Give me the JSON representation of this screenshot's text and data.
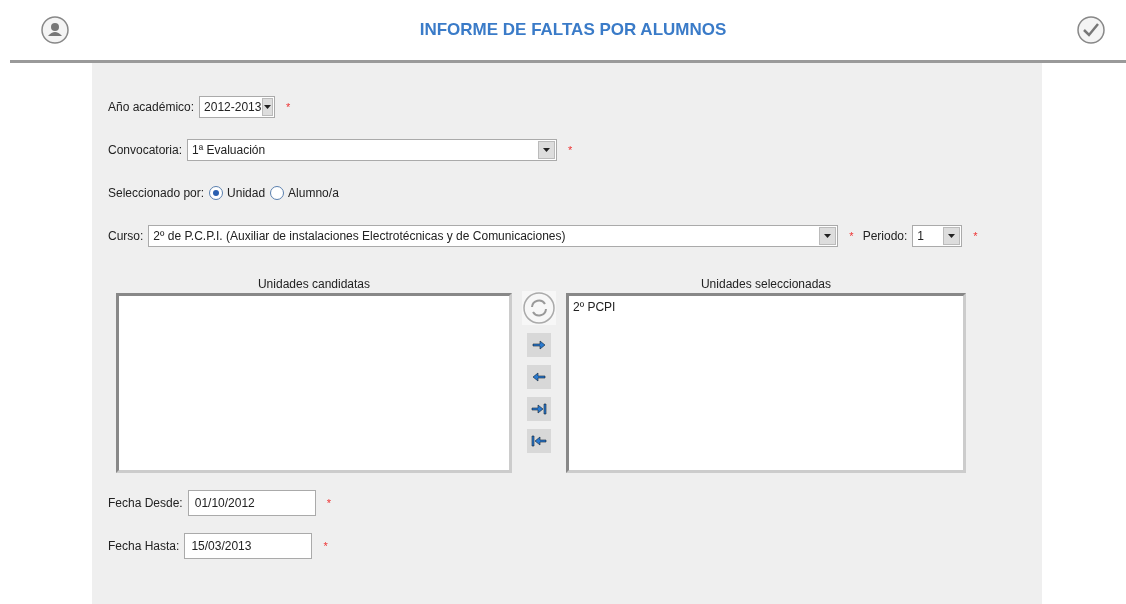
{
  "header": {
    "title": "INFORME DE FALTAS POR ALUMNOS"
  },
  "required_mark": "*",
  "academic_year": {
    "label": "Año académico:",
    "value": "2012-2013",
    "required": true
  },
  "call": {
    "label": "Convocatoria:",
    "value": "1ª Evaluación",
    "required": true
  },
  "selection": {
    "label": "Seleccionado por:",
    "options": [
      {
        "label": "Unidad",
        "selected": true
      },
      {
        "label": "Alumno/a",
        "selected": false
      }
    ]
  },
  "course": {
    "label": "Curso:",
    "value": "2º de P.C.P.I. (Auxiliar de instalaciones Electrotécnicas y de Comunicaciones)",
    "required": true
  },
  "period": {
    "label": "Periodo:",
    "value": "1",
    "required": true
  },
  "candidates": {
    "title": "Unidades candidatas"
  },
  "selected_units": {
    "title": "Unidades seleccionadas",
    "items": [
      "2º PCPI"
    ]
  },
  "date_from": {
    "label": "Fecha Desde:",
    "value": "01/10/2012",
    "required": true
  },
  "date_to": {
    "label": "Fecha Hasta:",
    "value": "15/03/2013",
    "required": true
  }
}
